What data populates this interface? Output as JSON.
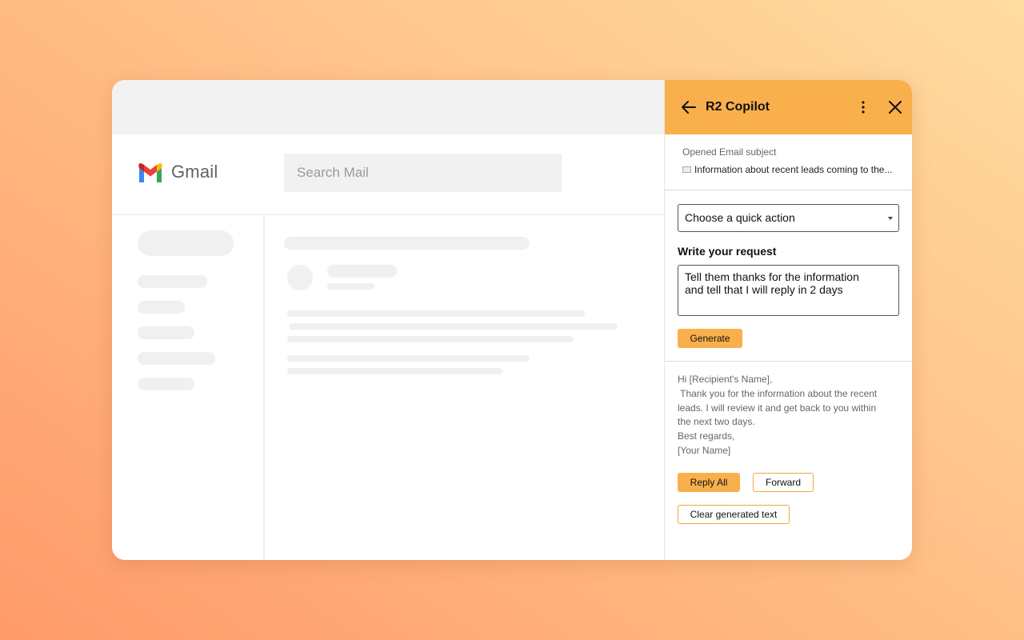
{
  "gmail": {
    "brand_name": "Gmail",
    "search_placeholder": "Search Mail"
  },
  "copilot": {
    "title": "R2 Copilot",
    "icons": {
      "back": "arrow-left-icon",
      "more": "more-vertical-icon",
      "close": "close-icon"
    },
    "subject_label": "Opened Email subject",
    "subject_text": "Information about recent leads coming to the...",
    "quick_action_placeholder": "Choose a quick action",
    "request_label": "Write your request",
    "request_value": "Tell them thanks for the information\nand tell that I will reply in 2 days",
    "generate_label": "Generate",
    "generated_lines": [
      "Hi [Recipient's Name],",
      " Thank you for the information about the recent",
      "leads. I will review it and get back to you within",
      "the next two days.",
      "Best regards,",
      "[Your Name]"
    ],
    "reply_all_label": "Reply All",
    "forward_label": "Forward",
    "clear_label": "Clear generated text"
  },
  "colors": {
    "accent": "#f9b04c",
    "skeleton": "#f0f0f0",
    "background_start": "#ff9a6a",
    "background_end": "#ffdca0"
  }
}
